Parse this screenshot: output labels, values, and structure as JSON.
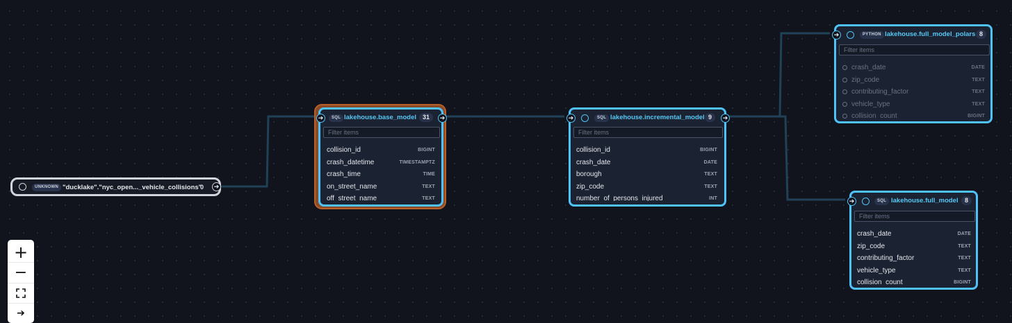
{
  "source": {
    "tag": "UNKNOWN",
    "title": "\"ducklake\".\"nyc_open..._vehicle_collisions\"",
    "count": "0"
  },
  "nodes": [
    {
      "tag": "SQL",
      "title": "lakehouse.base_model",
      "count": "31",
      "filter_placeholder": "Filter items",
      "columns": [
        {
          "name": "collision_id",
          "type": "BIGINT"
        },
        {
          "name": "crash_datetime",
          "type": "TIMESTAMPTZ"
        },
        {
          "name": "crash_time",
          "type": "TIME"
        },
        {
          "name": "on_street_name",
          "type": "TEXT"
        },
        {
          "name": "off_street_name",
          "type": "TEXT"
        }
      ]
    },
    {
      "tag": "SQL",
      "title": "lakehouse.incremental_model",
      "count": "9",
      "filter_placeholder": "Filter items",
      "columns": [
        {
          "name": "collision_id",
          "type": "BIGINT"
        },
        {
          "name": "crash_date",
          "type": "DATE"
        },
        {
          "name": "borough",
          "type": "TEXT"
        },
        {
          "name": "zip_code",
          "type": "TEXT"
        },
        {
          "name": "number_of_persons_injured",
          "type": "INT"
        }
      ]
    },
    {
      "tag": "PYTHON",
      "title": "lakehouse.full_model_polars",
      "count": "8",
      "filter_placeholder": "Filter items",
      "columns": [
        {
          "name": "crash_date",
          "type": "DATE"
        },
        {
          "name": "zip_code",
          "type": "TEXT"
        },
        {
          "name": "contributing_factor",
          "type": "TEXT"
        },
        {
          "name": "vehicle_type",
          "type": "TEXT"
        },
        {
          "name": "collision_count",
          "type": "BIGINT"
        }
      ]
    },
    {
      "tag": "SQL",
      "title": "lakehouse.full_model",
      "count": "8",
      "filter_placeholder": "Filter items",
      "columns": [
        {
          "name": "crash_date",
          "type": "DATE"
        },
        {
          "name": "zip_code",
          "type": "TEXT"
        },
        {
          "name": "contributing_factor",
          "type": "TEXT"
        },
        {
          "name": "vehicle_type",
          "type": "TEXT"
        },
        {
          "name": "collision_count",
          "type": "BIGINT"
        }
      ]
    }
  ],
  "controls": [
    {
      "icon": "zoom-in-icon",
      "symbol": "+"
    },
    {
      "icon": "zoom-out-icon",
      "symbol": "−"
    },
    {
      "icon": "fit-view-icon",
      "symbol": "⛶"
    },
    {
      "icon": "arrow-right-icon",
      "symbol": "➔"
    }
  ],
  "colors": {
    "background": "#11141c",
    "node_border": "#4fc3f7",
    "selected_outline": "#b8602a",
    "source_border": "#d1d5db",
    "edge": "#1f4257"
  }
}
